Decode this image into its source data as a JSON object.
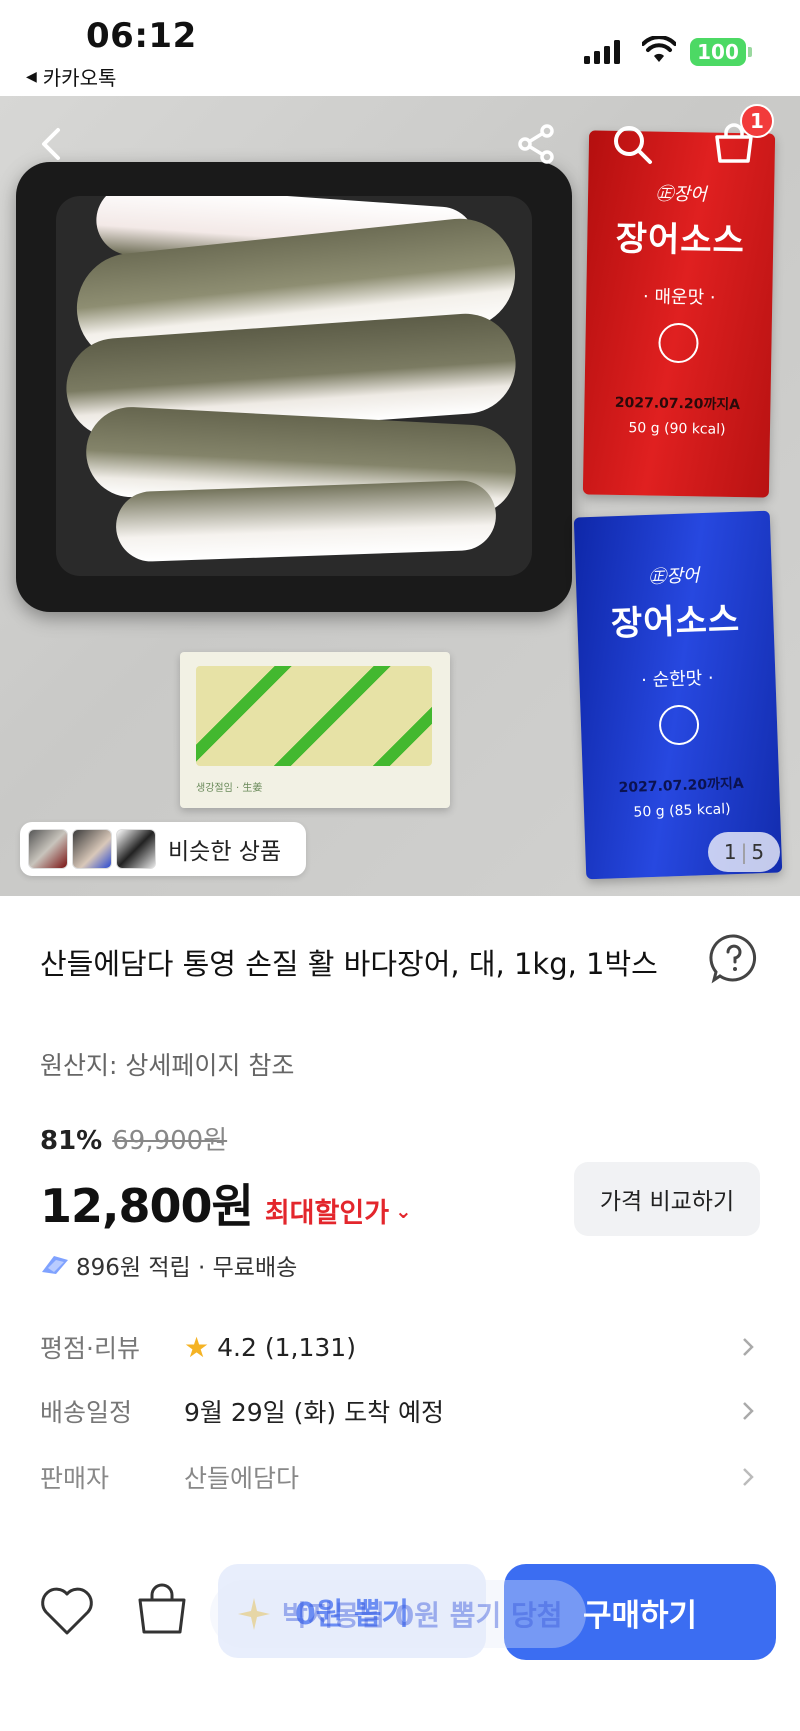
{
  "status_bar": {
    "time": "06:12",
    "back_app": "카카오톡",
    "battery": "100"
  },
  "hero": {
    "cart_count": "1",
    "similar_label": "비슷한 상품",
    "pager_current": "1",
    "pager_sep": "|",
    "pager_total": "5"
  },
  "product": {
    "title": "산들에담다 통영 손질 활 바다장어, 대, 1kg, 1박스",
    "origin": "원산지: 상세페이지 참조",
    "discount_rate": "81%",
    "original_price": "69,900원",
    "price": "12,800원",
    "max_discount_label": "최대할인가",
    "compare_label": "가격 비교하기",
    "points_text": "896원 적립 · 무료배송"
  },
  "info": {
    "rating_key": "평점·리뷰",
    "rating_value": "4.2",
    "review_count": "(1,131)",
    "delivery_key": "배송일정",
    "delivery_value": "9월 29일 (화) 도착 예정",
    "seller_key": "판매자",
    "seller_value": "산들에담다"
  },
  "bottom": {
    "zero_label": "0원 뽑기",
    "buy_label": "구매하기",
    "toast_text": "박지몽님 0원 뽑기 당첨"
  },
  "colors": {
    "accent_blue": "#3b6df2",
    "discount_red": "#e3262c",
    "badge_red": "#f23b3b",
    "star": "#f5b324",
    "battery_green": "#4cd964"
  },
  "icons": [
    "back-arrow-icon",
    "share-icon",
    "search-icon",
    "cart-icon",
    "help-icon",
    "star-icon",
    "chevron-right-icon",
    "heart-icon",
    "shopping-bag-icon",
    "points-icon"
  ]
}
